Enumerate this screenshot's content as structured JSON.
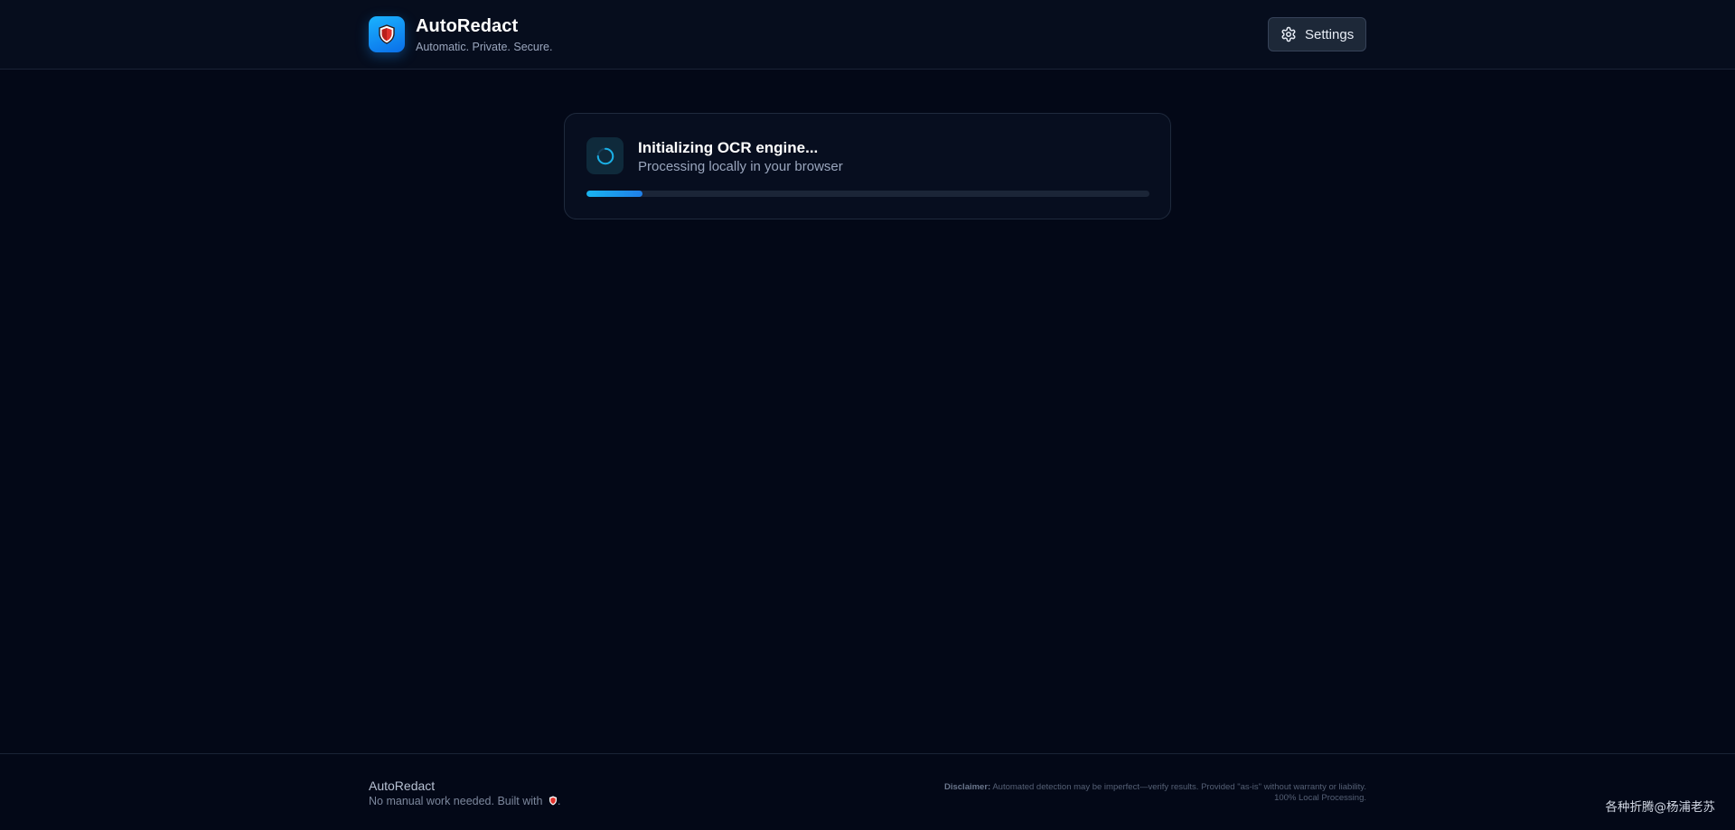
{
  "header": {
    "logo_icon": "shield-icon",
    "title": "AutoRedact",
    "tagline": "Automatic. Private. Secure.",
    "settings_icon": "gear-icon",
    "settings_label": "Settings"
  },
  "loading": {
    "spinner_icon": "spinner-icon",
    "title": "Initializing OCR engine...",
    "subtitle": "Processing locally in your browser",
    "progress_percent": 10
  },
  "footer": {
    "brand": "AutoRedact",
    "note": "No manual work needed. Built with",
    "note_icon": "shield-icon",
    "note_suffix": ".",
    "disclaimer_label": "Disclaimer:",
    "disclaimer_text": "Automated detection may be imperfect—verify results. Provided \"as-is\" without warranty or liability. 100% Local Processing."
  },
  "watermark": "各种折腾@杨浦老苏",
  "colors": {
    "accent": "#1a9cf0",
    "background": "#030817",
    "card": "#070e1f"
  }
}
